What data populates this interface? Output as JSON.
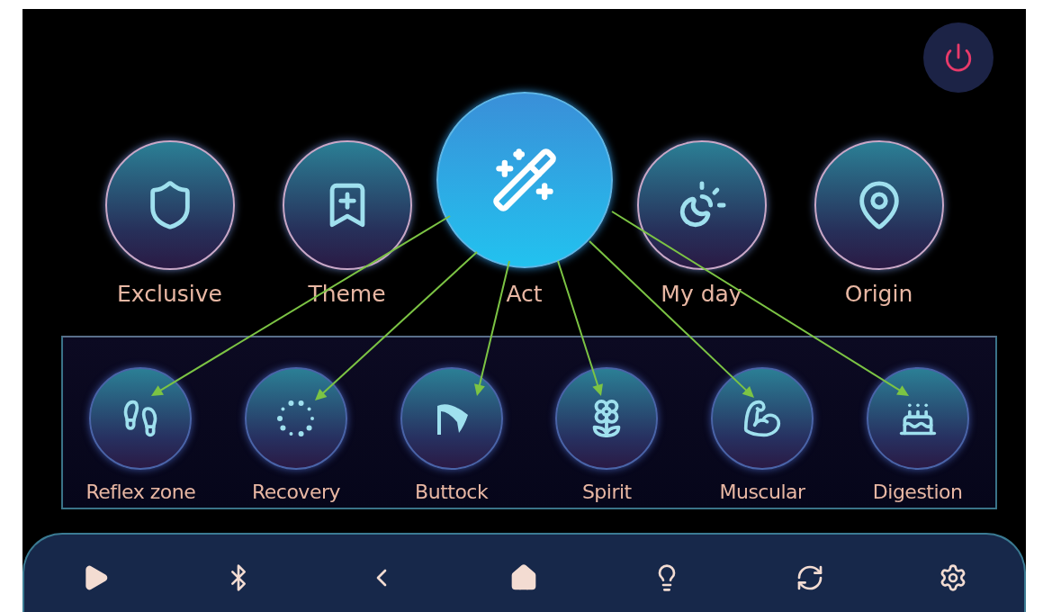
{
  "top_items": [
    {
      "label": "Exclusive",
      "selected": false
    },
    {
      "label": "Theme",
      "selected": false
    },
    {
      "label": "Act",
      "selected": true
    },
    {
      "label": "My day",
      "selected": false
    },
    {
      "label": "Origin",
      "selected": false
    }
  ],
  "sub_items": [
    {
      "label": "Reflex zone"
    },
    {
      "label": "Recovery"
    },
    {
      "label": "Buttock"
    },
    {
      "label": "Spirit"
    },
    {
      "label": "Muscular"
    },
    {
      "label": "Digestion"
    }
  ]
}
